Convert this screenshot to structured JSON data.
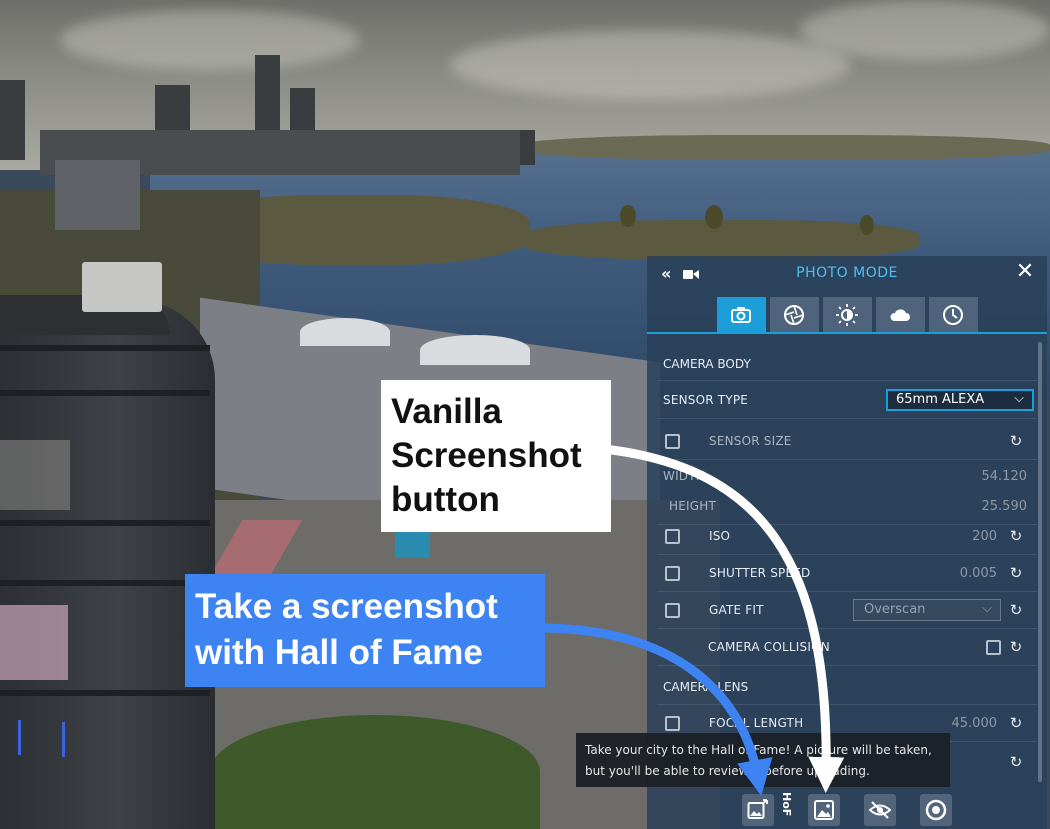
{
  "panel": {
    "title": "PHOTO MODE",
    "tabs": [
      {
        "icon": "camera-icon",
        "active": true
      },
      {
        "icon": "aperture-icon",
        "active": false
      },
      {
        "icon": "brightness-icon",
        "active": false
      },
      {
        "icon": "cloud-icon",
        "active": false
      },
      {
        "icon": "clock-icon",
        "active": false
      }
    ],
    "sections": {
      "camera_body": "CAMERA BODY",
      "camera_lens": "CAMERA LENS"
    },
    "rows": {
      "sensor_type": {
        "label": "SENSOR TYPE",
        "value": "65mm ALEXA"
      },
      "sensor_size": {
        "label": "SENSOR SIZE"
      },
      "width": {
        "label": "WIDTH",
        "value": "54.120"
      },
      "height": {
        "label": "HEIGHT",
        "value": "25.590"
      },
      "iso": {
        "label": "ISO",
        "value": "200"
      },
      "shutter_speed": {
        "label": "SHUTTER SPEED",
        "value": "0.005"
      },
      "gate_fit": {
        "label": "GATE FIT",
        "value": "Overscan"
      },
      "camera_collision": {
        "label": "CAMERA COLLISION"
      },
      "focal_length": {
        "label": "FOCAL LENGTH",
        "value": "45.000"
      }
    },
    "bottom_bar": {
      "hof_label": "HoF"
    },
    "accent_color": "#1c9fd9",
    "title_color": "#4fc0ee"
  },
  "tooltip": {
    "line1": "Take your city to the Hall of Fame! A picture will be taken,",
    "line2": "but you'll be able to review it before uploading."
  },
  "annotations": {
    "vanilla_lines": [
      "Vanilla",
      "Screenshot",
      "button"
    ],
    "hof_lines": [
      "Take a screenshot",
      "with Hall of Fame"
    ],
    "vanilla_color": "#ffffff",
    "hof_color": "#3d83f2"
  }
}
